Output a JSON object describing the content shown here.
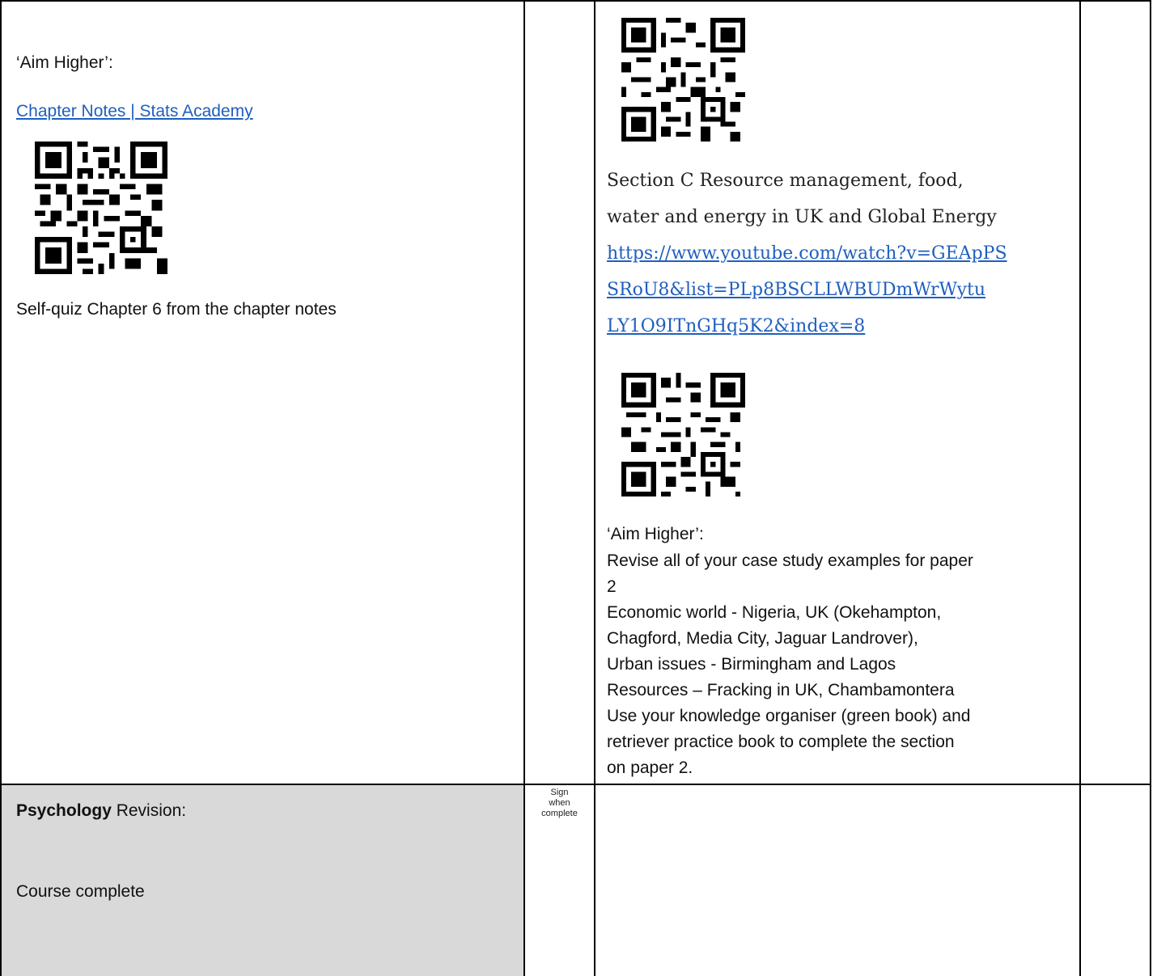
{
  "left_cell": {
    "aim_higher": "‘Aim Higher’:",
    "link_text": "Chapter Notes | Stats Academy",
    "qr_name": "qr-code",
    "quiz_text": "Self-quiz Chapter 6 from the chapter notes"
  },
  "right_cell": {
    "section_line1": "Section C Resource management, food,",
    "section_line2": "water and energy in UK and Global Energy",
    "url_line1": "https://www.youtube.com/watch?v=GEApPS",
    "url_line2": "SRoU8&list=PLp8BSCLLWBUDmWrWytu",
    "url_line3": "LY1O9ITnGHq5K2&index=8",
    "aim_higher": "‘Aim Higher’:",
    "lines": [
      "Revise all of your case study examples for paper",
      "2",
      "Economic world - Nigeria, UK (Okehampton,",
      "Chagford, Media City, Jaguar Landrover),",
      "Urban issues - Birmingham and Lagos",
      "Resources – Fracking in UK, Chambamontera",
      "Use your knowledge organiser (green book) and",
      "retriever practice book to complete the section",
      "on paper 2."
    ]
  },
  "bottom_row": {
    "subject": "Psychology",
    "revision": " Revision:",
    "status": "Course complete",
    "sign_line1": "Sign",
    "sign_line2": "when",
    "sign_line3": "complete"
  },
  "colors": {
    "link": "#1f5fbf",
    "gray_cell": "#d9d9d9",
    "border": "#000000"
  }
}
